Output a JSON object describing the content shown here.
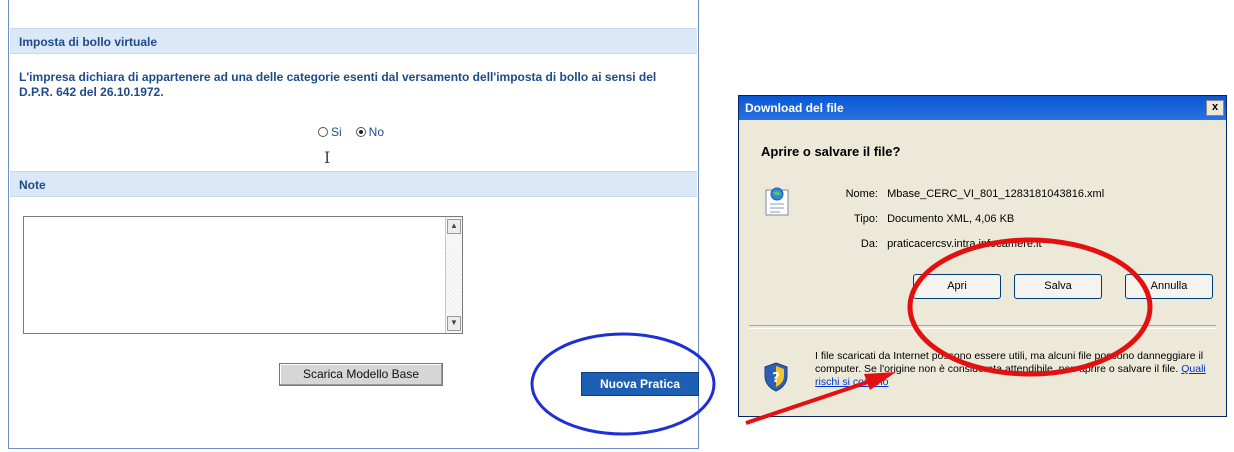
{
  "form": {
    "bollo_header": "Imposta di bollo virtuale",
    "bollo_text": "L'impresa dichiara di appartenere ad una delle categorie esenti dal versamento dell'imposta di bollo ai sensi del D.P.R. 642 del 26.10.1972.",
    "radio_si": "Si",
    "radio_no": "No",
    "radio_selected": "No",
    "note_header": "Note",
    "note_value": "",
    "scarica_button": "Scarica Modello Base",
    "nuova_button": "Nuova Pratica",
    "scroll_up": "▲",
    "scroll_down": "▼"
  },
  "dialog": {
    "title": "Download del file",
    "close": "x",
    "question": "Aprire o salvare il file?",
    "name_label": "Nome:",
    "name_value": "Mbase_CERC_VI_801_1283181043816.xml",
    "type_label": "Tipo:",
    "type_value": "Documento XML, 4,06 KB",
    "from_label": "Da:",
    "from_value": "praticacercsv.intra.infocamere.it",
    "apri_button": "Apri",
    "salva_button": "Salva",
    "annulla_button": "Annulla",
    "warning_text": "I file scaricati da Internet possono essere utili, ma alcuni file possono danneggiare il computer. Se l'origine non è considerata attendibile, non aprire o salvare il file.",
    "warning_link": "Quali rischi si corrono"
  },
  "annotations": {
    "blue_ellipse_color": "#1d2fd6",
    "red_ellipse_color": "#e41010",
    "arrow_color": "#e41010"
  }
}
